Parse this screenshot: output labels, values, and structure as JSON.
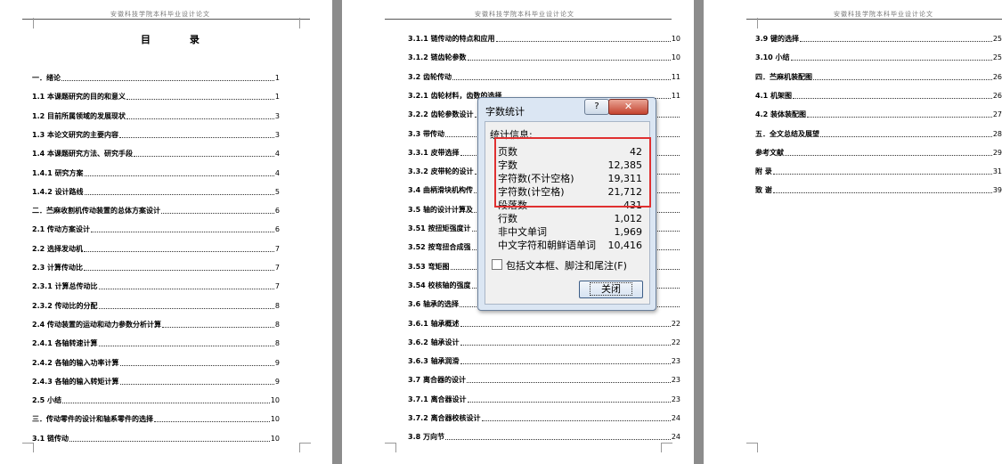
{
  "pages": {
    "header_text": "安徽科技学院本科毕业设计论文",
    "left": {
      "title": "目 录",
      "entries": [
        {
          "t": "一．绪论",
          "p": "1"
        },
        {
          "t": "1.1  本课题研究的目的和意义",
          "p": "1"
        },
        {
          "t": "1.2  目前所属领域的发展现状",
          "p": "3"
        },
        {
          "t": "1.3  本论文研究的主要内容",
          "p": "3"
        },
        {
          "t": "1.4  本课题研究方法、研究手段",
          "p": "4"
        },
        {
          "t": "1.4.1  研究方案",
          "p": "4"
        },
        {
          "t": "1.4.2  设计路线",
          "p": "5"
        },
        {
          "t": "二．苎麻收割机传动装置的总体方案设计",
          "p": "6"
        },
        {
          "t": "2.1  传动方案设计",
          "p": "6"
        },
        {
          "t": "2.2  选择发动机",
          "p": "7"
        },
        {
          "t": "2.3  计算传动比",
          "p": "7"
        },
        {
          "t": "2.3.1  计算总传动比",
          "p": "7"
        },
        {
          "t": "2.3.2  传动比的分配",
          "p": "8"
        },
        {
          "t": "2.4  传动装置的运动和动力参数分析计算",
          "p": "8"
        },
        {
          "t": "2.4.1  各轴转速计算",
          "p": "8"
        },
        {
          "t": "2.4.2  各轴的输入功率计算",
          "p": "9"
        },
        {
          "t": "2.4.3  各轴的输入转矩计算",
          "p": "9"
        },
        {
          "t": "2.5  小结",
          "p": "10"
        },
        {
          "t": "三．传动零件的设计和轴系零件的选择",
          "p": "10"
        },
        {
          "t": "3.1  链传动",
          "p": "10"
        }
      ]
    },
    "middle": {
      "entries": [
        {
          "t": "3.1.1  链传动的特点和应用",
          "p": "10"
        },
        {
          "t": "3.1.2  链齿轮参数",
          "p": "10"
        },
        {
          "t": "3.2  齿轮传动",
          "p": "11"
        },
        {
          "t": "3.2.1  齿轮材料，齿数的选择",
          "p": "11"
        },
        {
          "t": "3.2.2  齿轮参数设计",
          "p": ""
        },
        {
          "t": "3.3  带传动",
          "p": ""
        },
        {
          "t": "3.3.1  皮带选择",
          "p": ""
        },
        {
          "t": "3.3.2  皮带轮的设计",
          "p": ""
        },
        {
          "t": "3.4 曲柄滑块机构传",
          "p": ""
        },
        {
          "t": "3.5 轴的设计计算及",
          "p": ""
        },
        {
          "t": "3.51  按扭矩强度计",
          "p": ""
        },
        {
          "t": "3.52  按弯扭合成强",
          "p": ""
        },
        {
          "t": "3.53  弯矩图",
          "p": ""
        },
        {
          "t": "3.54  校核轴的强度",
          "p": ""
        },
        {
          "t": "3.6 轴承的选择",
          "p": ""
        },
        {
          "t": "3.6.1 轴承概述",
          "p": "22"
        },
        {
          "t": "3.6.2 轴承设计",
          "p": "22"
        },
        {
          "t": "3.6.3 轴承润滑",
          "p": "23"
        },
        {
          "t": "3.7 离合器的设计",
          "p": "23"
        },
        {
          "t": "3.7.1 离合器设计",
          "p": "23"
        },
        {
          "t": "3.7.2 离合器校核设计",
          "p": "24"
        },
        {
          "t": "3.8 万向节",
          "p": "24"
        }
      ]
    },
    "right": {
      "entries": [
        {
          "t": "3.9 键的选择",
          "p": "25"
        },
        {
          "t": "3.10 小结",
          "p": "25"
        },
        {
          "t": "四．苎麻机装配图",
          "p": "26"
        },
        {
          "t": "4.1 机架图",
          "p": "26"
        },
        {
          "t": "4.2 装体装配图",
          "p": "27"
        },
        {
          "t": "五．全文总结及展望",
          "p": "28"
        },
        {
          "t": "参考文献",
          "p": "29"
        },
        {
          "t": "附    录",
          "p": "31"
        },
        {
          "t": "致    谢",
          "p": "39"
        }
      ]
    }
  },
  "dialog": {
    "title": "字数统计",
    "help_label": "?",
    "close_label": "✕",
    "stats_label": "统计信息:",
    "stats": [
      {
        "k": "页数",
        "v": "42"
      },
      {
        "k": "字数",
        "v": "12,385"
      },
      {
        "k": "字符数(不计空格)",
        "v": "19,311"
      },
      {
        "k": "字符数(计空格)",
        "v": "21,712"
      },
      {
        "k": "段落数",
        "v": "431"
      },
      {
        "k": "行数",
        "v": "1,012"
      },
      {
        "k": "非中文单词",
        "v": "1,969"
      },
      {
        "k": "中文字符和朝鲜语单词",
        "v": "10,416"
      }
    ],
    "checkbox_label": "包括文本框、脚注和尾注(F)",
    "checkbox_checked": false,
    "ok_label": "关闭",
    "highlight_color": "#e03030"
  }
}
